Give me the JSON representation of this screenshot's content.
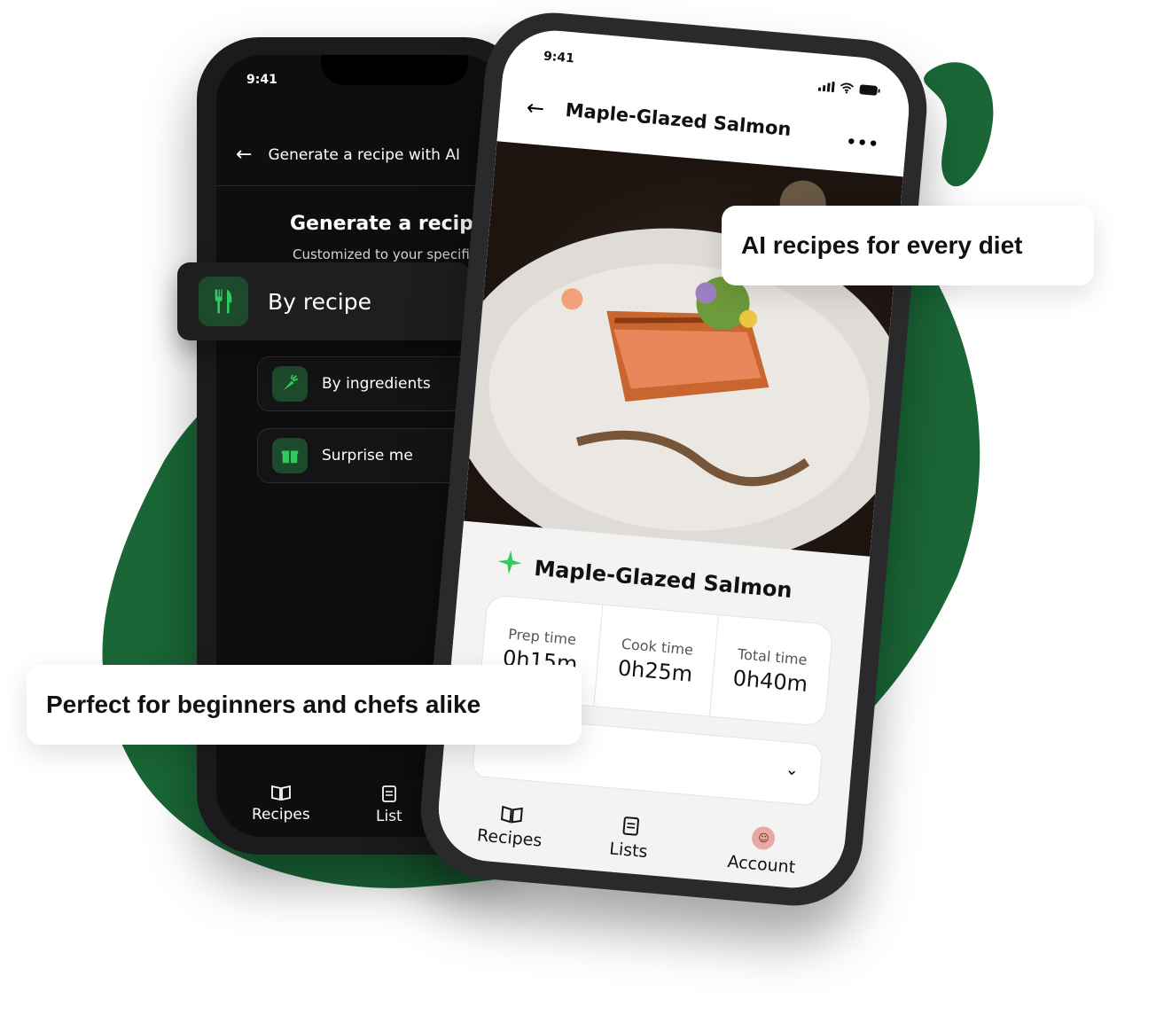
{
  "back_phone": {
    "status_time": "9:41",
    "header_title": "Generate a recipe with AI",
    "heading": "Generate a recipe w",
    "subheading": "Customized to your specifica",
    "options": [
      {
        "label": "By recipe",
        "icon": "utensils-icon"
      },
      {
        "label": "By ingredients",
        "icon": "carrot-icon"
      },
      {
        "label": "Surprise me",
        "icon": "gift-icon"
      }
    ],
    "nav": [
      {
        "label": "Recipes",
        "icon": "book-icon"
      },
      {
        "label": "List",
        "icon": "clipboard-icon"
      }
    ]
  },
  "front_phone": {
    "status_time": "9:41",
    "header_title": "Maple-Glazed Salmon",
    "recipe_title": "Maple-Glazed Salmon",
    "times": [
      {
        "label": "Prep time",
        "value": "0h15m"
      },
      {
        "label": "Cook time",
        "value": "0h25m"
      },
      {
        "label": "Total time",
        "value": "0h40m"
      }
    ],
    "nav": [
      {
        "label": "Recipes",
        "icon": "book-icon"
      },
      {
        "label": "Lists",
        "icon": "clipboard-icon"
      },
      {
        "label": "Account",
        "icon": "avatar"
      }
    ]
  },
  "callouts": {
    "top": "AI recipes for every diet",
    "bottom": "Perfect for beginners and chefs alike"
  },
  "colors": {
    "brand_green": "#1a6636",
    "accent_green": "#2fcb5f"
  }
}
